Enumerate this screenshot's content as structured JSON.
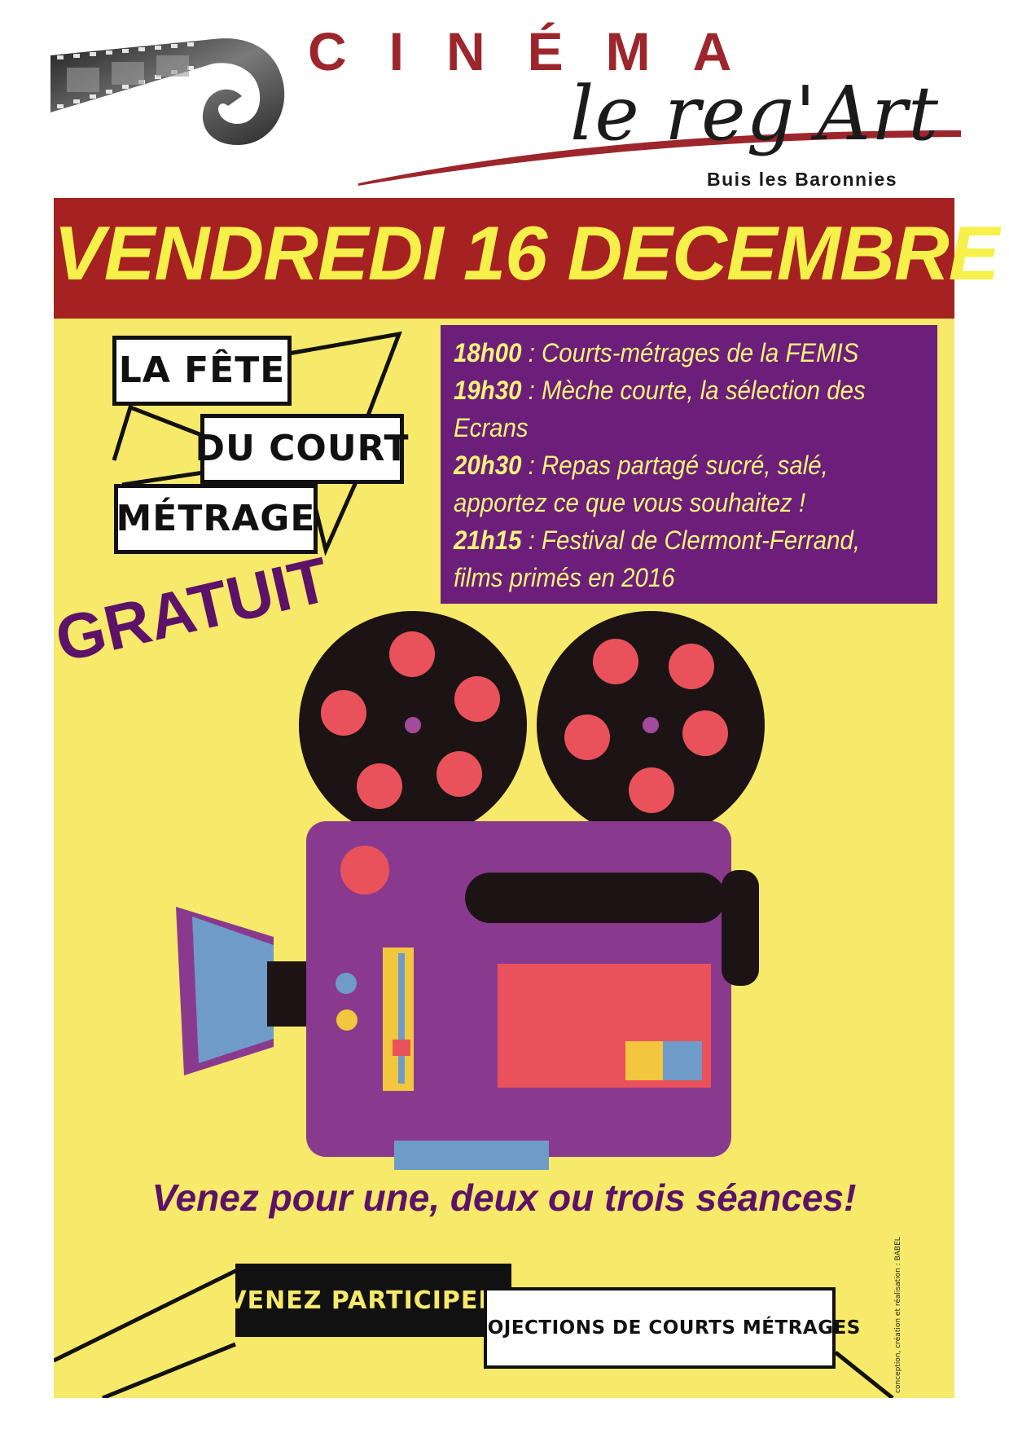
{
  "header": {
    "cinema": "CINÉMA",
    "name": "le reg'Art",
    "town": "Buis les Baronnies"
  },
  "event": {
    "date": "VENDREDI 16 DECEMBRE",
    "logo_lines": [
      "LA FÊTE",
      "DU COURT",
      "MÉTRAGE"
    ],
    "schedule": [
      {
        "time": "18h00",
        "text": " : Courts-métrages de la FEMIS"
      },
      {
        "time": "19h30",
        "text": " : Mèche courte, la sélection des"
      },
      {
        "time": "",
        "text": "Ecrans"
      },
      {
        "time": "20h30",
        "text": " : Repas partagé sucré, salé,"
      },
      {
        "time": "",
        "text": "apportez ce que vous souhaitez !"
      },
      {
        "time": "21h15",
        "text": " : Festival de Clermont-Ferrand,"
      },
      {
        "time": "",
        "text": "films primés en 2016"
      }
    ],
    "price": "GRATUIT",
    "invitation": "Venez pour une, deux ou trois séances!"
  },
  "banner": {
    "participate": "VENEZ PARTICIPER !",
    "projections": "PROJECTIONS DE COURTS MÉTRAGES",
    "credit": "conception, création et réalisation : BABEL"
  },
  "colors": {
    "brand_red": "#9c262c",
    "band_red": "#a62121",
    "poster_yellow": "#f7e96a",
    "date_yellow": "#f5f04a",
    "schedule_purple": "#6b1f7a",
    "camera_purple": "#8a3a8e"
  },
  "icons": [
    "film-strip-icon",
    "film-camera-icon"
  ]
}
